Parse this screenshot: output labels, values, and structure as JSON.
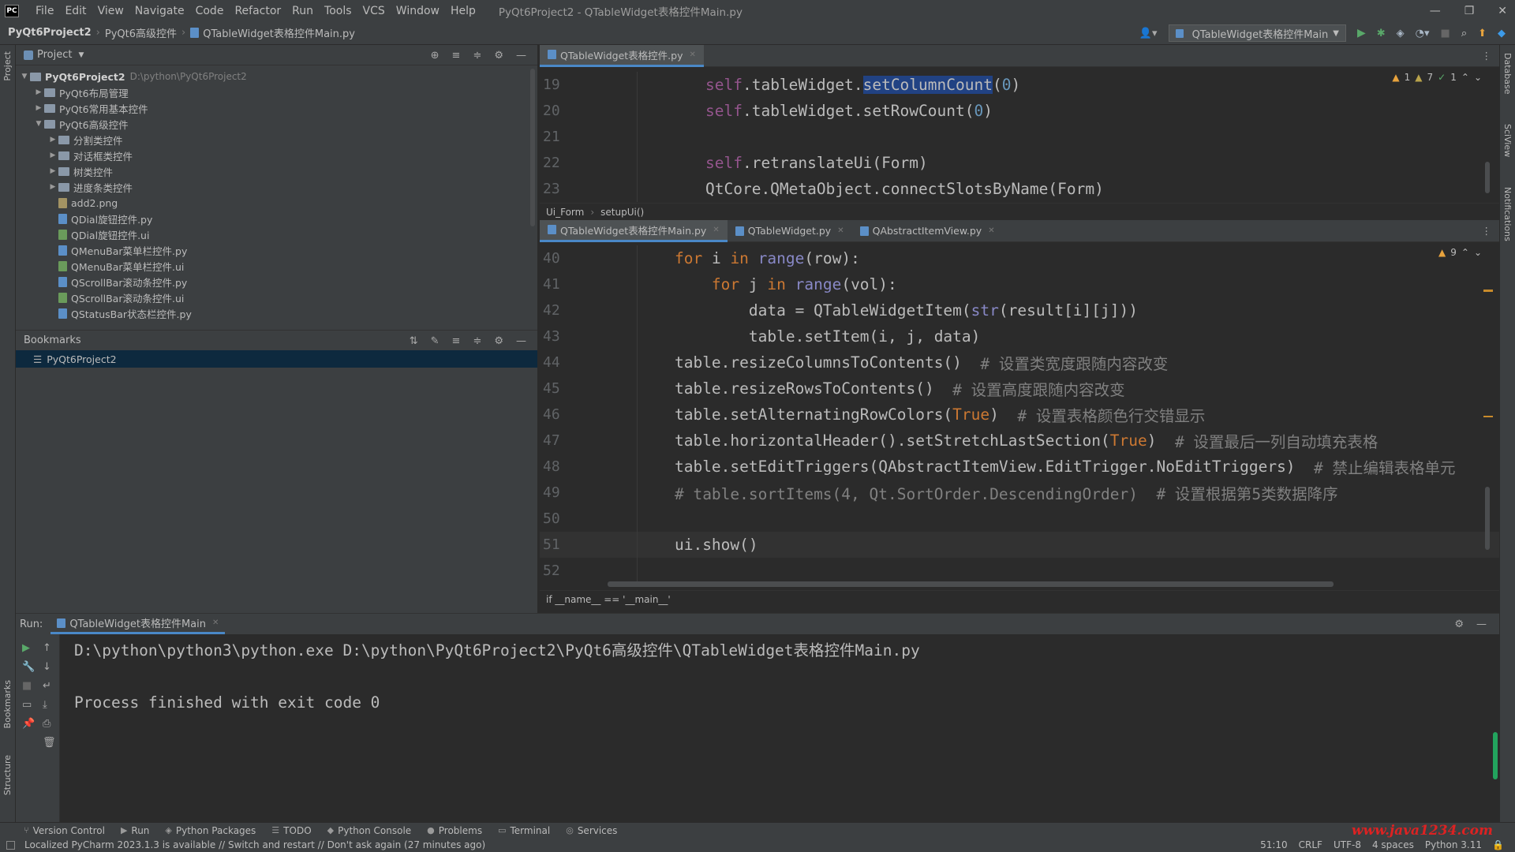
{
  "titlebar": {
    "logo": "PC",
    "menu": [
      "File",
      "Edit",
      "View",
      "Navigate",
      "Code",
      "Refactor",
      "Run",
      "Tools",
      "VCS",
      "Window",
      "Help"
    ],
    "title": "PyQt6Project2 - QTableWidget表格控件Main.py"
  },
  "navbar": {
    "crumbs": [
      "PyQt6Project2",
      "PyQt6高级控件",
      "QTableWidget表格控件Main.py"
    ],
    "run_config": "QTableWidget表格控件Main"
  },
  "left_strip": {
    "project": "Project",
    "bookmarks": "Bookmarks",
    "structure": "Structure"
  },
  "right_strip": {
    "database": "Database",
    "sciview": "SciView",
    "notifications": "Notifications"
  },
  "project": {
    "header": "Project",
    "root": "PyQt6Project2",
    "root_path": "D:\\python\\PyQt6Project2",
    "items": [
      {
        "label": "PyQt6布局管理",
        "type": "folder",
        "level": 1,
        "arrow": "▶"
      },
      {
        "label": "PyQt6常用基本控件",
        "type": "folder",
        "level": 1,
        "arrow": "▶"
      },
      {
        "label": "PyQt6高级控件",
        "type": "folder",
        "level": 1,
        "arrow": "▼"
      },
      {
        "label": "分割类控件",
        "type": "folder",
        "level": 2,
        "arrow": "▶"
      },
      {
        "label": "对话框类控件",
        "type": "folder",
        "level": 2,
        "arrow": "▶"
      },
      {
        "label": "树类控件",
        "type": "folder",
        "level": 2,
        "arrow": "▶"
      },
      {
        "label": "进度条类控件",
        "type": "folder",
        "level": 2,
        "arrow": "▶"
      },
      {
        "label": "add2.png",
        "type": "img",
        "level": 2,
        "arrow": ""
      },
      {
        "label": "QDial旋钮控件.py",
        "type": "py",
        "level": 2,
        "arrow": ""
      },
      {
        "label": "QDial旋钮控件.ui",
        "type": "ui",
        "level": 2,
        "arrow": ""
      },
      {
        "label": "QMenuBar菜单栏控件.py",
        "type": "py",
        "level": 2,
        "arrow": ""
      },
      {
        "label": "QMenuBar菜单栏控件.ui",
        "type": "ui",
        "level": 2,
        "arrow": ""
      },
      {
        "label": "QScrollBar滚动条控件.py",
        "type": "py",
        "level": 2,
        "arrow": ""
      },
      {
        "label": "QScrollBar滚动条控件.ui",
        "type": "ui",
        "level": 2,
        "arrow": ""
      },
      {
        "label": "QStatusBar状态栏控件.py",
        "type": "py",
        "level": 2,
        "arrow": ""
      }
    ],
    "bookmarks_header": "Bookmarks",
    "bookmark_item": "PyQt6Project2"
  },
  "editor_top": {
    "tab": "QTableWidget表格控件.py",
    "inspections": {
      "warn1": "1",
      "warn2": "7",
      "ok": "1"
    },
    "breadcrumb": [
      "Ui_Form",
      "setupUi()"
    ],
    "lines": [
      {
        "n": "19",
        "pre": "self",
        "a": ".tableWidget.",
        "sel": "setColumnCount",
        "b": "(",
        "num": "0",
        "c": ")"
      },
      {
        "n": "20",
        "pre": "self",
        "a": ".tableWidget.setRowCount(",
        "num": "0",
        "c": ")"
      },
      {
        "n": "21"
      },
      {
        "n": "22",
        "pre": "self",
        "a": ".retranslateUi(Form)"
      },
      {
        "n": "23",
        "a": "QtCore.QMetaObject.connectSlotsByName(Form)"
      }
    ]
  },
  "editor_bottom": {
    "tabs": [
      "QTableWidget表格控件Main.py",
      "QTableWidget.py",
      "QAbstractItemView.py"
    ],
    "warnings": "9",
    "breadcrumb": "if __name__ == '__main__'",
    "lines": [
      {
        "n": "40",
        "indent": "    ",
        "kw": "for",
        "a": " i ",
        "kw2": "in",
        "b": " ",
        "bi": "range",
        "c": "(row):"
      },
      {
        "n": "41",
        "indent": "        ",
        "kw": "for",
        "a": " j ",
        "kw2": "in",
        "b": " ",
        "bi": "range",
        "c": "(vol):"
      },
      {
        "n": "42",
        "indent": "            ",
        "a": "data = QTableWidgetItem(",
        "bi": "str",
        "c": "(result[i][j]))"
      },
      {
        "n": "43",
        "indent": "            ",
        "a": "table.setItem(i, j, data)"
      },
      {
        "n": "44",
        "indent": "    ",
        "a": "table.resizeColumnsToContents()",
        "cm": "  # 设置类宽度跟随内容改变"
      },
      {
        "n": "45",
        "indent": "    ",
        "a": "table.resizeRowsToContents()",
        "cm": "  # 设置高度跟随内容改变"
      },
      {
        "n": "46",
        "indent": "    ",
        "a": "table.setAlternatingRowColors(",
        "tr": "True",
        "c": ")",
        "cm": "  # 设置表格颜色行交错显示"
      },
      {
        "n": "47",
        "indent": "    ",
        "a": "table.horizontalHeader().setStretchLastSection(",
        "tr": "True",
        "c": ")",
        "cm": "  # 设置最后一列自动填充表格"
      },
      {
        "n": "48",
        "indent": "    ",
        "a": "table.setEditTriggers(QAbstractItemView.EditTrigger.NoEditTriggers)",
        "cm": "  # 禁止编辑表格单元"
      },
      {
        "n": "49",
        "indent": "    ",
        "cm": "# table.sortItems(4, Qt.SortOrder.DescendingOrder)  # 设置根据第5类数据降序"
      },
      {
        "n": "50"
      },
      {
        "n": "51",
        "indent": "    ",
        "a": "ui.show()"
      },
      {
        "n": "52"
      }
    ]
  },
  "run": {
    "label": "Run:",
    "tab": "QTableWidget表格控件Main",
    "output1": "D:\\python\\python3\\python.exe D:\\python\\PyQt6Project2\\PyQt6高级控件\\QTableWidget表格控件Main.py",
    "output2": "Process finished with exit code 0"
  },
  "bottom_tools": [
    "Version Control",
    "Run",
    "Python Packages",
    "TODO",
    "Python Console",
    "Problems",
    "Terminal",
    "Services"
  ],
  "status": {
    "message": "Localized PyCharm 2023.1.3 is available // Switch and restart // Don't ask again (27 minutes ago)",
    "position": "51:10",
    "line_sep": "CRLF",
    "encoding": "UTF-8",
    "indent": "4 spaces",
    "interpreter": "Python 3.11",
    "watermark": "www.java1234.com"
  }
}
